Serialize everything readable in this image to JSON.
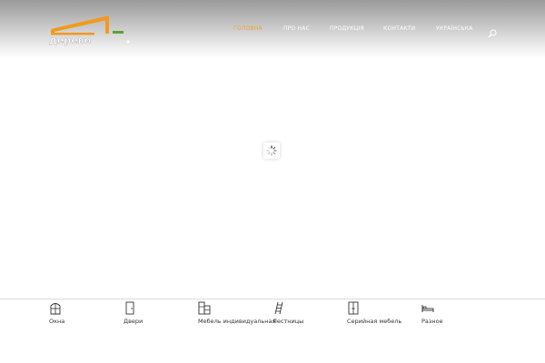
{
  "header": {
    "nav": [
      {
        "label": "Головна",
        "active": true
      },
      {
        "label": "Про нас",
        "active": false
      },
      {
        "label": "Продукція",
        "active": false
      },
      {
        "label": "Контакти",
        "active": false
      },
      {
        "label": "Українська",
        "active": false
      }
    ],
    "search_icon": "search-icon"
  },
  "colors": {
    "accent": "#f0a030",
    "logo_orange": "#f29a1e",
    "logo_green": "#5aa52f"
  },
  "categories": [
    {
      "label": "Окна",
      "icon": "window-icon"
    },
    {
      "label": "Двери",
      "icon": "door-icon"
    },
    {
      "label": "Мебель индивидуальная",
      "icon": "wardrobe-icon"
    },
    {
      "label": "Лестницы",
      "icon": "ladder-icon"
    },
    {
      "label": "Серийная мебель",
      "icon": "cabinet-icon"
    },
    {
      "label": "Разное",
      "icon": "bed-icon"
    }
  ]
}
